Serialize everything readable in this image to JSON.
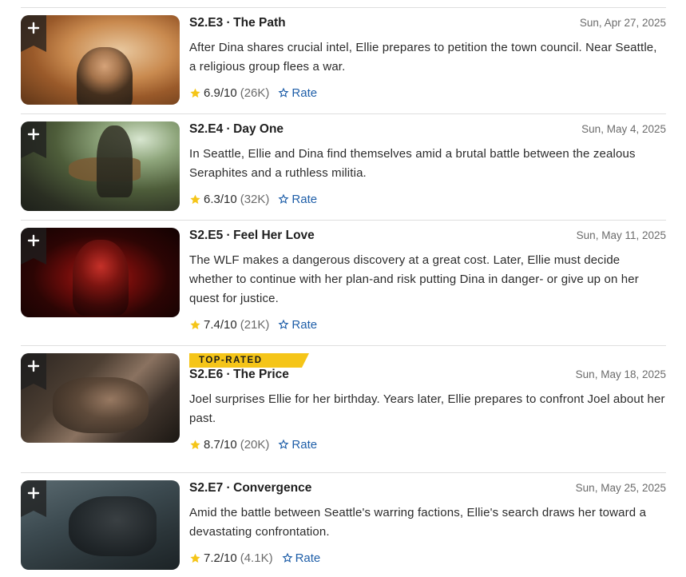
{
  "colors": {
    "accent_star": "#f5c518",
    "link_blue": "#1e5ea8",
    "divider": "#dedede"
  },
  "episodes": [
    {
      "title": "S2.E3 ∙ The Path",
      "air_date": "Sun, Apr 27, 2025",
      "plot": "After Dina shares crucial intel, Ellie prepares to petition the town council. Near Seattle, a religious group flees a war.",
      "rating": "6.9/10",
      "votes": "(26K)",
      "rate_label": "Rate",
      "badge": "",
      "watchlist_icon": "plus-icon"
    },
    {
      "title": "S2.E4 ∙ Day One",
      "air_date": "Sun, May 4, 2025",
      "plot": "In Seattle, Ellie and Dina find themselves amid a brutal battle between the zealous Seraphites and a ruthless militia.",
      "rating": "6.3/10",
      "votes": "(32K)",
      "rate_label": "Rate",
      "badge": "",
      "watchlist_icon": "plus-icon"
    },
    {
      "title": "S2.E5 ∙ Feel Her Love",
      "air_date": "Sun, May 11, 2025",
      "plot": "The WLF makes a dangerous discovery at a great cost. Later, Ellie must decide whether to continue with her plan-and risk putting Dina in danger- or give up on her quest for justice.",
      "rating": "7.4/10",
      "votes": "(21K)",
      "rate_label": "Rate",
      "badge": "",
      "watchlist_icon": "plus-icon"
    },
    {
      "title": "S2.E6 ∙ The Price",
      "air_date": "Sun, May 18, 2025",
      "plot": "Joel surprises Ellie for her birthday. Years later, Ellie prepares to confront Joel about her past.",
      "rating": "8.7/10",
      "votes": "(20K)",
      "rate_label": "Rate",
      "badge": "TOP-RATED",
      "watchlist_icon": "plus-icon"
    },
    {
      "title": "S2.E7 ∙ Convergence",
      "air_date": "Sun, May 25, 2025",
      "plot": "Amid the battle between Seattle's warring factions, Ellie's search draws her toward a devastating confrontation.",
      "rating": "7.2/10",
      "votes": "(4.1K)",
      "rate_label": "Rate",
      "badge": "",
      "watchlist_icon": "plus-icon"
    }
  ]
}
